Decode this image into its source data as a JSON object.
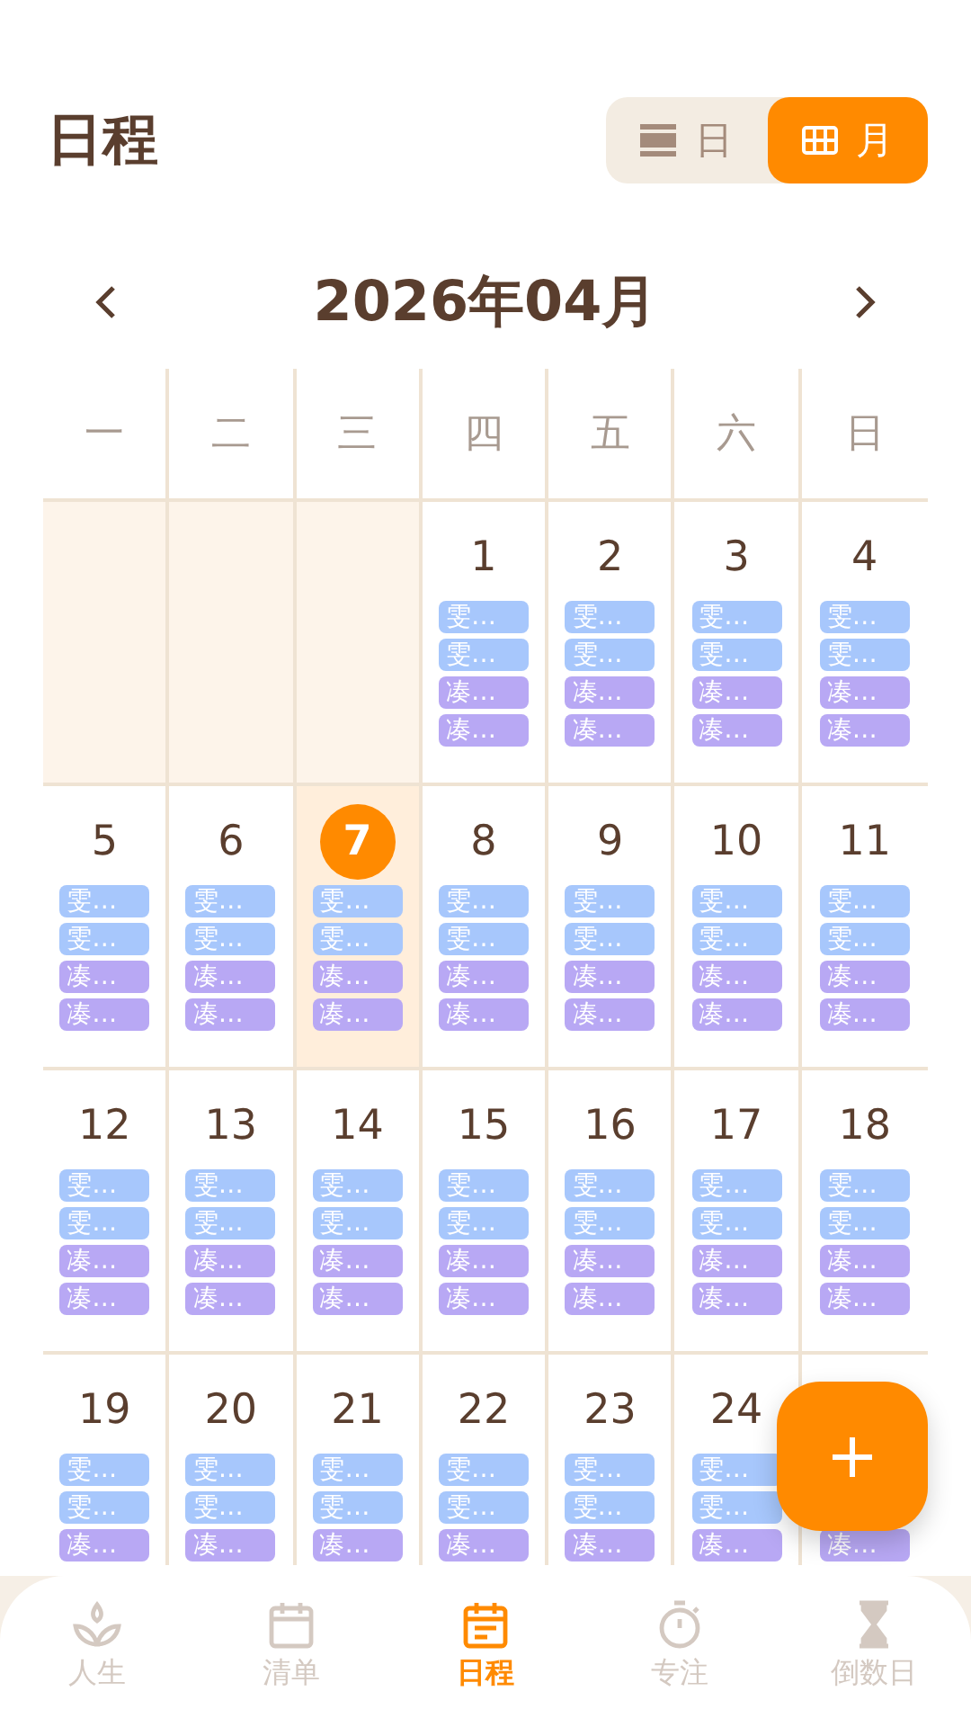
{
  "header": {
    "title": "日程",
    "view_toggle": [
      {
        "label": "日",
        "kind": "list",
        "selected": false
      },
      {
        "label": "月",
        "kind": "grid",
        "selected": true
      }
    ]
  },
  "month_nav": {
    "title": "2026年04月"
  },
  "calendar": {
    "weekdays": [
      "一",
      "二",
      "三",
      "四",
      "五",
      "六",
      "日"
    ],
    "weeks": [
      [
        {
          "kind": "blank"
        },
        {
          "kind": "blank"
        },
        {
          "kind": "blank"
        },
        {
          "kind": "day",
          "day": "1",
          "selected": false,
          "events": [
            {
              "kind": "event",
              "text": "雯…",
              "color": "#a7c7fc"
            },
            {
              "kind": "event",
              "text": "雯…",
              "color": "#a7c7fc"
            },
            {
              "kind": "event",
              "text": "凑…",
              "color": "#b8a8f4"
            },
            {
              "kind": "event",
              "text": "凑…",
              "color": "#b8a8f4"
            }
          ]
        },
        {
          "kind": "day",
          "day": "2",
          "selected": false,
          "events": [
            {
              "kind": "event",
              "text": "雯…",
              "color": "#a7c7fc"
            },
            {
              "kind": "event",
              "text": "雯…",
              "color": "#a7c7fc"
            },
            {
              "kind": "event",
              "text": "凑…",
              "color": "#b8a8f4"
            },
            {
              "kind": "event",
              "text": "凑…",
              "color": "#b8a8f4"
            }
          ]
        },
        {
          "kind": "day",
          "day": "3",
          "selected": false,
          "events": [
            {
              "kind": "event",
              "text": "雯…",
              "color": "#a7c7fc"
            },
            {
              "kind": "event",
              "text": "雯…",
              "color": "#a7c7fc"
            },
            {
              "kind": "event",
              "text": "凑…",
              "color": "#b8a8f4"
            },
            {
              "kind": "event",
              "text": "凑…",
              "color": "#b8a8f4"
            }
          ]
        },
        {
          "kind": "day",
          "day": "4",
          "selected": false,
          "events": [
            {
              "kind": "event",
              "text": "雯…",
              "color": "#a7c7fc"
            },
            {
              "kind": "event",
              "text": "雯…",
              "color": "#a7c7fc"
            },
            {
              "kind": "event",
              "text": "凑…",
              "color": "#b8a8f4"
            },
            {
              "kind": "event",
              "text": "凑…",
              "color": "#b8a8f4"
            }
          ]
        }
      ],
      [
        {
          "kind": "day",
          "day": "5",
          "selected": false,
          "events": [
            {
              "kind": "event",
              "text": "雯…",
              "color": "#a7c7fc"
            },
            {
              "kind": "event",
              "text": "雯…",
              "color": "#a7c7fc"
            },
            {
              "kind": "event",
              "text": "凑…",
              "color": "#b8a8f4"
            },
            {
              "kind": "event",
              "text": "凑…",
              "color": "#b8a8f4"
            }
          ]
        },
        {
          "kind": "day",
          "day": "6",
          "selected": false,
          "events": [
            {
              "kind": "event",
              "text": "雯…",
              "color": "#a7c7fc"
            },
            {
              "kind": "event",
              "text": "雯…",
              "color": "#a7c7fc"
            },
            {
              "kind": "event",
              "text": "凑…",
              "color": "#b8a8f4"
            },
            {
              "kind": "event",
              "text": "凑…",
              "color": "#b8a8f4"
            }
          ]
        },
        {
          "kind": "day",
          "day": "7",
          "selected": true,
          "events": [
            {
              "kind": "event",
              "text": "雯…",
              "color": "#a7c7fc"
            },
            {
              "kind": "event",
              "text": "雯…",
              "color": "#a7c7fc"
            },
            {
              "kind": "event",
              "text": "凑…",
              "color": "#b8a8f4"
            },
            {
              "kind": "event",
              "text": "凑…",
              "color": "#b8a8f4"
            }
          ]
        },
        {
          "kind": "day",
          "day": "8",
          "selected": false,
          "events": [
            {
              "kind": "event",
              "text": "雯…",
              "color": "#a7c7fc"
            },
            {
              "kind": "event",
              "text": "雯…",
              "color": "#a7c7fc"
            },
            {
              "kind": "event",
              "text": "凑…",
              "color": "#b8a8f4"
            },
            {
              "kind": "event",
              "text": "凑…",
              "color": "#b8a8f4"
            }
          ]
        },
        {
          "kind": "day",
          "day": "9",
          "selected": false,
          "events": [
            {
              "kind": "event",
              "text": "雯…",
              "color": "#a7c7fc"
            },
            {
              "kind": "event",
              "text": "雯…",
              "color": "#a7c7fc"
            },
            {
              "kind": "event",
              "text": "凑…",
              "color": "#b8a8f4"
            },
            {
              "kind": "event",
              "text": "凑…",
              "color": "#b8a8f4"
            }
          ]
        },
        {
          "kind": "day",
          "day": "10",
          "selected": false,
          "events": [
            {
              "kind": "event",
              "text": "雯…",
              "color": "#a7c7fc"
            },
            {
              "kind": "event",
              "text": "雯…",
              "color": "#a7c7fc"
            },
            {
              "kind": "event",
              "text": "凑…",
              "color": "#b8a8f4"
            },
            {
              "kind": "event",
              "text": "凑…",
              "color": "#b8a8f4"
            }
          ]
        },
        {
          "kind": "day",
          "day": "11",
          "selected": false,
          "events": [
            {
              "kind": "event",
              "text": "雯…",
              "color": "#a7c7fc"
            },
            {
              "kind": "event",
              "text": "雯…",
              "color": "#a7c7fc"
            },
            {
              "kind": "event",
              "text": "凑…",
              "color": "#b8a8f4"
            },
            {
              "kind": "event",
              "text": "凑…",
              "color": "#b8a8f4"
            }
          ]
        }
      ],
      [
        {
          "kind": "day",
          "day": "12",
          "selected": false,
          "events": [
            {
              "kind": "event",
              "text": "雯…",
              "color": "#a7c7fc"
            },
            {
              "kind": "event",
              "text": "雯…",
              "color": "#a7c7fc"
            },
            {
              "kind": "event",
              "text": "凑…",
              "color": "#b8a8f4"
            },
            {
              "kind": "event",
              "text": "凑…",
              "color": "#b8a8f4"
            }
          ]
        },
        {
          "kind": "day",
          "day": "13",
          "selected": false,
          "events": [
            {
              "kind": "event",
              "text": "雯…",
              "color": "#a7c7fc"
            },
            {
              "kind": "event",
              "text": "雯…",
              "color": "#a7c7fc"
            },
            {
              "kind": "event",
              "text": "凑…",
              "color": "#b8a8f4"
            },
            {
              "kind": "event",
              "text": "凑…",
              "color": "#b8a8f4"
            }
          ]
        },
        {
          "kind": "day",
          "day": "14",
          "selected": false,
          "events": [
            {
              "kind": "event",
              "text": "雯…",
              "color": "#a7c7fc"
            },
            {
              "kind": "event",
              "text": "雯…",
              "color": "#a7c7fc"
            },
            {
              "kind": "event",
              "text": "凑…",
              "color": "#b8a8f4"
            },
            {
              "kind": "event",
              "text": "凑…",
              "color": "#b8a8f4"
            }
          ]
        },
        {
          "kind": "day",
          "day": "15",
          "selected": false,
          "events": [
            {
              "kind": "event",
              "text": "雯…",
              "color": "#a7c7fc"
            },
            {
              "kind": "event",
              "text": "雯…",
              "color": "#a7c7fc"
            },
            {
              "kind": "event",
              "text": "凑…",
              "color": "#b8a8f4"
            },
            {
              "kind": "event",
              "text": "凑…",
              "color": "#b8a8f4"
            }
          ]
        },
        {
          "kind": "day",
          "day": "16",
          "selected": false,
          "events": [
            {
              "kind": "event",
              "text": "雯…",
              "color": "#a7c7fc"
            },
            {
              "kind": "event",
              "text": "雯…",
              "color": "#a7c7fc"
            },
            {
              "kind": "event",
              "text": "凑…",
              "color": "#b8a8f4"
            },
            {
              "kind": "event",
              "text": "凑…",
              "color": "#b8a8f4"
            }
          ]
        },
        {
          "kind": "day",
          "day": "17",
          "selected": false,
          "events": [
            {
              "kind": "event",
              "text": "雯…",
              "color": "#a7c7fc"
            },
            {
              "kind": "event",
              "text": "雯…",
              "color": "#a7c7fc"
            },
            {
              "kind": "event",
              "text": "凑…",
              "color": "#b8a8f4"
            },
            {
              "kind": "event",
              "text": "凑…",
              "color": "#b8a8f4"
            }
          ]
        },
        {
          "kind": "day",
          "day": "18",
          "selected": false,
          "events": [
            {
              "kind": "event",
              "text": "雯…",
              "color": "#a7c7fc"
            },
            {
              "kind": "event",
              "text": "雯…",
              "color": "#a7c7fc"
            },
            {
              "kind": "event",
              "text": "凑…",
              "color": "#b8a8f4"
            },
            {
              "kind": "event",
              "text": "凑…",
              "color": "#b8a8f4"
            }
          ]
        }
      ],
      [
        {
          "kind": "day",
          "day": "19",
          "selected": false,
          "events": [
            {
              "kind": "event",
              "text": "雯…",
              "color": "#a7c7fc"
            },
            {
              "kind": "event",
              "text": "雯…",
              "color": "#a7c7fc"
            },
            {
              "kind": "event",
              "text": "凑…",
              "color": "#b8a8f4"
            }
          ]
        },
        {
          "kind": "day",
          "day": "20",
          "selected": false,
          "events": [
            {
              "kind": "event",
              "text": "雯…",
              "color": "#a7c7fc"
            },
            {
              "kind": "event",
              "text": "雯…",
              "color": "#a7c7fc"
            },
            {
              "kind": "event",
              "text": "凑…",
              "color": "#b8a8f4"
            }
          ]
        },
        {
          "kind": "day",
          "day": "21",
          "selected": false,
          "events": [
            {
              "kind": "event",
              "text": "雯…",
              "color": "#a7c7fc"
            },
            {
              "kind": "event",
              "text": "雯…",
              "color": "#a7c7fc"
            },
            {
              "kind": "event",
              "text": "凑…",
              "color": "#b8a8f4"
            }
          ]
        },
        {
          "kind": "day",
          "day": "22",
          "selected": false,
          "events": [
            {
              "kind": "event",
              "text": "雯…",
              "color": "#a7c7fc"
            },
            {
              "kind": "event",
              "text": "雯…",
              "color": "#a7c7fc"
            },
            {
              "kind": "event",
              "text": "凑…",
              "color": "#b8a8f4"
            }
          ]
        },
        {
          "kind": "day",
          "day": "23",
          "selected": false,
          "events": [
            {
              "kind": "event",
              "text": "雯…",
              "color": "#a7c7fc"
            },
            {
              "kind": "event",
              "text": "雯…",
              "color": "#a7c7fc"
            },
            {
              "kind": "event",
              "text": "凑…",
              "color": "#b8a8f4"
            }
          ]
        },
        {
          "kind": "day",
          "day": "24",
          "selected": false,
          "events": [
            {
              "kind": "event",
              "text": "雯…",
              "color": "#a7c7fc"
            },
            {
              "kind": "event",
              "text": "雯…",
              "color": "#a7c7fc"
            },
            {
              "kind": "event",
              "text": "凑…",
              "color": "#b8a8f4"
            }
          ]
        },
        {
          "kind": "day",
          "events": [
            {
              "kind": "covered"
            },
            {
              "kind": "covered"
            },
            {
              "kind": "event",
              "text": "凑…",
              "color": "#b8a8f4"
            }
          ]
        }
      ]
    ]
  },
  "bottom_nav": {
    "items": [
      {
        "label": "人生",
        "kind": "sprout",
        "selected": false
      },
      {
        "label": "清单",
        "kind": "calendar",
        "selected": false
      },
      {
        "label": "日程",
        "kind": "schedule",
        "selected": true
      },
      {
        "label": "专注",
        "kind": "stopwatch",
        "selected": false
      },
      {
        "label": "倒数日",
        "kind": "hourglass",
        "selected": false
      }
    ]
  }
}
